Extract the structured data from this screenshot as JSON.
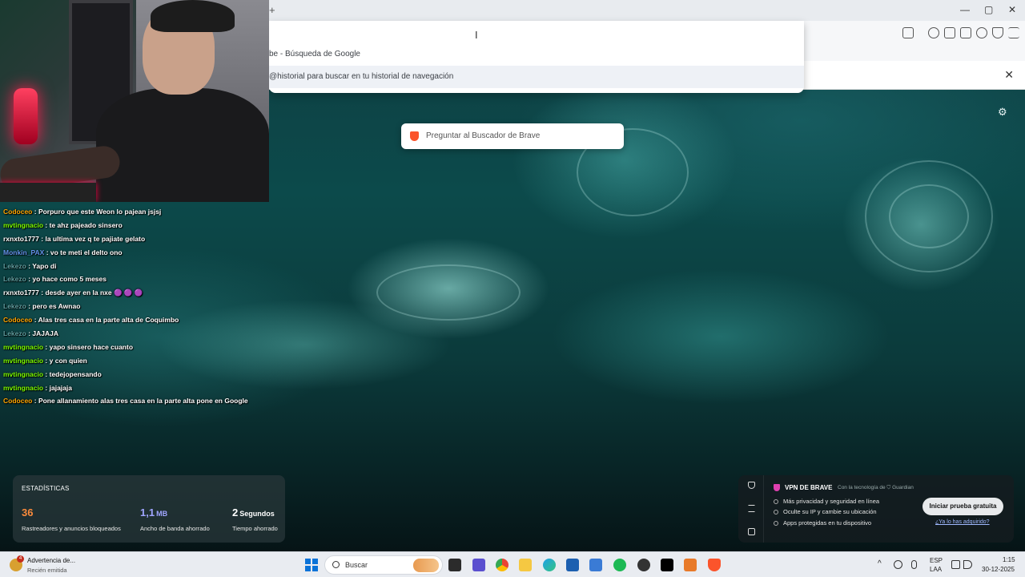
{
  "browser": {
    "new_tab_glyph": "+",
    "window_controls": [
      "—",
      "▢",
      "✕"
    ],
    "omnibox_caret": "I",
    "suggestions": [
      "be - Búsqueda de Google",
      "@historial para buscar en tu historial de navegación"
    ],
    "infobar_close": "✕"
  },
  "new_tab_page": {
    "search_placeholder": "Preguntar al Buscador de Brave",
    "settings_icon": "gear-icon",
    "stats": {
      "title": "ESTADÍSTICAS",
      "items": [
        {
          "value": "36",
          "unit": "",
          "label": "Rastreadores y anuncios bloqueados",
          "color": "#fb8b3c"
        },
        {
          "value": "1,1",
          "unit": "MB",
          "label": "Ancho de banda ahorrado",
          "color": "#a0a5ff"
        },
        {
          "value": "2",
          "unit": "Segundos",
          "label": "Tiempo ahorrado",
          "color": "#ffffff"
        }
      ]
    },
    "vpn": {
      "title": "VPN DE BRAVE",
      "powered_by": "Con la tecnología de ⛉ Guardian",
      "features": [
        "Más privacidad y seguridad en línea",
        "Oculte su IP y cambie su ubicación",
        "Apps protegidas en tu dispositivo"
      ],
      "cta": "Iniciar prueba gratuita",
      "link": "¿Ya lo has adquirido?"
    }
  },
  "chat": [
    {
      "user": "Codoceo",
      "color": "#ffa500",
      "msg": "Porpuro que este Weon lo pajean jsjsj"
    },
    {
      "user": "mvtingnacio",
      "color": "#7cfc00",
      "msg": "te ahz pajeado sinsero"
    },
    {
      "user": "rxnxto1777",
      "color": "#ffffff",
      "msg": "la ultima vez q te pajiate gelato"
    },
    {
      "user": "Monkin_PAX",
      "color": "#6495ed",
      "msg": "vo te meti el delto ono"
    },
    {
      "user": "Lekezo",
      "color": "#5f9ea0",
      "msg": "Yapo di"
    },
    {
      "user": "Lekezo",
      "color": "#5f9ea0",
      "msg": "yo hace como 5 meses"
    },
    {
      "user": "rxnxto1777",
      "color": "#ffffff",
      "msg": "desde ayer en la nxe 🟣 🟣 🟣"
    },
    {
      "user": "Lekezo",
      "color": "#5f9ea0",
      "msg": "pero es Awnao"
    },
    {
      "user": "Codoceo",
      "color": "#ffa500",
      "msg": "Alas tres casa en la parte alta de Coquimbo"
    },
    {
      "user": "Lekezo",
      "color": "#5f9ea0",
      "msg": "JAJAJA"
    },
    {
      "user": "mvtingnacio",
      "color": "#7cfc00",
      "msg": "yapo sinsero hace cuanto"
    },
    {
      "user": "mvtingnacio",
      "color": "#7cfc00",
      "msg": "y con quien"
    },
    {
      "user": "mvtingnacio",
      "color": "#7cfc00",
      "msg": "tedejopensando"
    },
    {
      "user": "mvtingnacio",
      "color": "#7cfc00",
      "msg": "jajajaja"
    },
    {
      "user": "Codoceo",
      "color": "#ffa500",
      "msg": "Pone allanamiento alas tres casa en la parte alta pone en Google"
    }
  ],
  "taskbar": {
    "notification_title": "Advertencia de...",
    "notification_sub": "Recién emitida",
    "notification_badge": "4",
    "search_label": "Buscar",
    "lang_top": "ESP",
    "lang_bottom": "LAA",
    "time": "1:15",
    "date": "30-12-2025",
    "tray_chevron": "^"
  }
}
